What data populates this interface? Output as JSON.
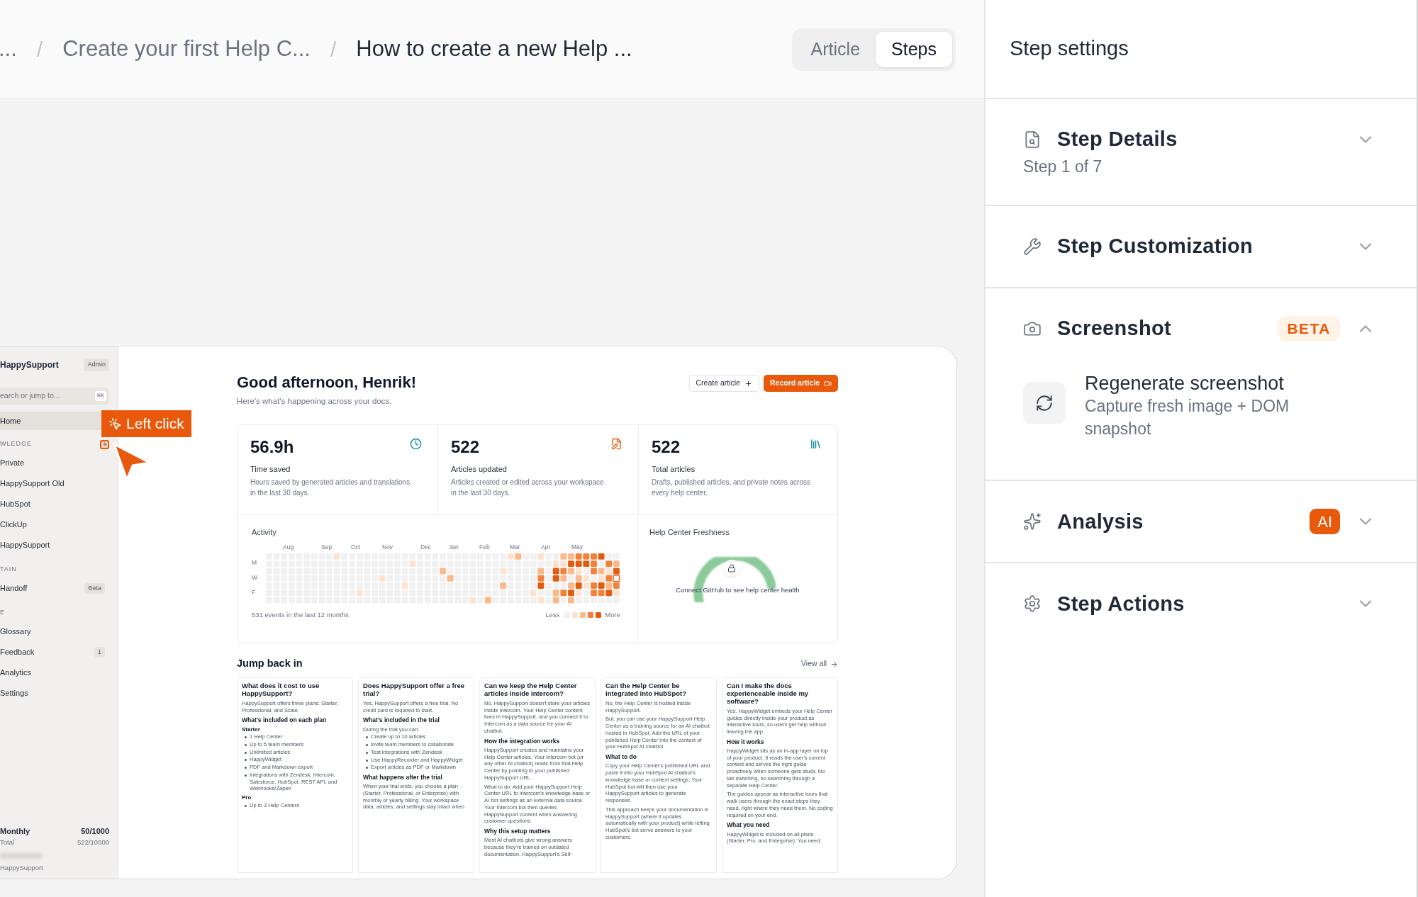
{
  "breadcrumb": [
    {
      "kind": "crumb",
      "label": "...",
      "current": false
    },
    {
      "kind": "separator",
      "label": "/"
    },
    {
      "kind": "crumb",
      "label": "Create your first Help C...",
      "current": false
    },
    {
      "kind": "separator",
      "label": "/"
    },
    {
      "kind": "crumb",
      "label": "How to create a new Help ...",
      "current": true
    }
  ],
  "view_tabs": [
    {
      "label": "Article",
      "selected": false
    },
    {
      "label": "Steps",
      "selected": true
    }
  ],
  "captured_screen": {
    "sidebar": {
      "brand": "HappySupport",
      "role_badge": "Admin",
      "search_placeholder": "earch or jump to...",
      "search_shortcut": "⌘K",
      "items": [
        {
          "kind": "item",
          "label": "Home",
          "selected": true
        },
        {
          "kind": "section",
          "label": "WLEDGE",
          "has_add": true
        },
        {
          "kind": "item",
          "label": "Private",
          "selected": false
        },
        {
          "kind": "item",
          "label": "HappySupport Old",
          "selected": false
        },
        {
          "kind": "item",
          "label": "HubSpot",
          "selected": false
        },
        {
          "kind": "item",
          "label": "ClickUp",
          "selected": false
        },
        {
          "kind": "item",
          "label": "HappySupport",
          "selected": false
        },
        {
          "kind": "section",
          "label": "TAIN",
          "has_add": false
        },
        {
          "kind": "item",
          "label": "Handoff",
          "selected": false,
          "badge": "Beta"
        },
        {
          "kind": "section",
          "label": "E",
          "has_add": false
        },
        {
          "kind": "item",
          "label": "Glossary",
          "selected": false
        },
        {
          "kind": "item",
          "label": "Feedback",
          "selected": false,
          "badge": "1"
        },
        {
          "kind": "item",
          "label": "Analytics",
          "selected": false
        },
        {
          "kind": "item",
          "label": "Settings",
          "selected": false
        }
      ],
      "usage": [
        {
          "label": "Monthly",
          "value": "50/1000"
        },
        {
          "label": "Total",
          "value": "522/10000"
        }
      ],
      "workspace": "HappySupport"
    },
    "greeting": "Good afternoon, Henrik!",
    "greeting_subtitle": "Here's what's happening across your docs.",
    "buttons": [
      {
        "label": "Create article",
        "kind": "secondary"
      },
      {
        "label": "Record article",
        "kind": "primary"
      }
    ],
    "stats": [
      {
        "value": "56.9h",
        "label": "Time saved",
        "description": "Hours saved by generated articles and translations in the last 30 days."
      },
      {
        "value": "522",
        "label": "Articles updated",
        "description": "Articles created or edited across your workspace in the last 30 days."
      },
      {
        "value": "522",
        "label": "Total articles",
        "description": "Drafts, published articles, and private notes across every help center."
      }
    ],
    "activity": {
      "title": "Activity",
      "months": [
        "Aug",
        "Sep",
        "Oct",
        "Nov",
        "Dec",
        "Jan",
        "Feb",
        "Mar",
        "Apr",
        "May"
      ],
      "days": [
        "M",
        "W",
        "F"
      ],
      "summary": "531 events in the last 12 months",
      "legend_less": "Less",
      "legend_more": "More"
    },
    "freshness": {
      "title": "Help Center Freshness",
      "message": "Connect GitHub to see help center health"
    },
    "jump_back": {
      "title": "Jump back in",
      "view_all": "View all",
      "cards": [
        {
          "blocks": [
            {
              "kind": "title",
              "text": "What does it cost to use HappySupport?"
            },
            {
              "kind": "text",
              "text": "HappySupport offers three plans: Starter, Professional, and Scale."
            },
            {
              "kind": "heading",
              "text": "What's included on each plan"
            },
            {
              "kind": "subheading",
              "text": "Starter"
            },
            {
              "kind": "bullet",
              "text": "1 Help Center"
            },
            {
              "kind": "bullet",
              "text": "Up to 5 team members"
            },
            {
              "kind": "bullet",
              "text": "Unlimited articles"
            },
            {
              "kind": "bullet",
              "text": "HappyWidget"
            },
            {
              "kind": "bullet",
              "text": "PDF and Markdown export"
            },
            {
              "kind": "bullet",
              "text": "Integrations with Zendesk, Intercom, Salesforce, HubSpot, REST API, and Webhooks/Zapier"
            },
            {
              "kind": "subheading",
              "text": "Pro"
            },
            {
              "kind": "bullet",
              "text": "Up to 3 Help Centers"
            }
          ]
        },
        {
          "blocks": [
            {
              "kind": "title",
              "text": "Does HappySupport offer a free trial?"
            },
            {
              "kind": "text",
              "text": "Yes, HappySupport offers a free trial. No credit card is required to start."
            },
            {
              "kind": "heading",
              "text": "What's included in the trial"
            },
            {
              "kind": "text",
              "text": "During the trial you can:"
            },
            {
              "kind": "bullet",
              "text": "Create up to 10 articles"
            },
            {
              "kind": "bullet",
              "text": "Invite team members to collaborate"
            },
            {
              "kind": "bullet",
              "text": "Test integrations with Zendesk"
            },
            {
              "kind": "bullet",
              "text": "Use HappyRecorder and HappyWidget"
            },
            {
              "kind": "bullet",
              "text": "Export articles as PDF or Markdown"
            },
            {
              "kind": "heading",
              "text": "What happens after the trial"
            },
            {
              "kind": "text",
              "text": "When your trial ends, you choose a plan (Starter, Professional, or Enterprise) with monthly or yearly billing. Your workspace data, articles, and settings stay intact when"
            }
          ]
        },
        {
          "blocks": [
            {
              "kind": "title",
              "text": "Can we keep the Help Center articles inside Intercom?"
            },
            {
              "kind": "text",
              "text": "No, HappySupport doesn't store your articles inside Intercom. Your Help Center content lives in HappySupport, and you connect it to Intercom as a data source for your AI chatbot."
            },
            {
              "kind": "heading",
              "text": "How the integration works"
            },
            {
              "kind": "text",
              "text": "HappySupport creates and maintains your Help Center articles. Your Intercom bot (or any other AI chatbot) reads from that Help Center by pointing to your published HappySupport URL."
            },
            {
              "kind": "text",
              "text": "What to do: Add your HappySupport Help Center URL to Intercom's knowledge base or AI bot settings as an external data source. Your Intercom bot then queries HappySupport content when answering customer questions."
            },
            {
              "kind": "heading",
              "text": "Why this setup matters"
            },
            {
              "kind": "text",
              "text": "Most AI chatbots give wrong answers because they're trained on outdated documentation. HappySupport's Self-"
            }
          ]
        },
        {
          "blocks": [
            {
              "kind": "title",
              "text": "Can the Help Center be integrated into HubSpot?"
            },
            {
              "kind": "text",
              "text": "No, the Help Center is hosted inside HappySupport."
            },
            {
              "kind": "text",
              "text": "But, you can use your HappySupport Help Center as a training source for an AI chatbot hosted in HubSpot. Add the URL of your published Help Center into the context of your HubSpot AI chatbot."
            },
            {
              "kind": "heading",
              "text": "What to do"
            },
            {
              "kind": "text",
              "text": "Copy your Help Center's published URL and paste it into your HubSpot AI chatbot's knowledge base or context settings. Your HubSpot bot will then use your HappySupport articles to generate responses."
            },
            {
              "kind": "text",
              "text": "This approach keeps your documentation in HappySupport (where it updates automatically with your product) while letting HubSpot's bot serve answers to your customers."
            }
          ]
        },
        {
          "blocks": [
            {
              "kind": "title",
              "text": "Can I make the docs experienceable inside my software?"
            },
            {
              "kind": "text",
              "text": "Yes. HappyWidget embeds your Help Center guides directly inside your product as interactive tours, so users get help without leaving the app."
            },
            {
              "kind": "heading",
              "text": "How it works"
            },
            {
              "kind": "text",
              "text": "HappyWidget sits as an in-app layer on top of your product. It reads the user's current context and serves the right guide proactively when someone gets stuck. No tab switching, no searching through a separate Help Center."
            },
            {
              "kind": "text",
              "text": "The guides appear as interactive tours that walk users through the exact steps they need, right where they need them. No coding required on your end."
            },
            {
              "kind": "heading",
              "text": "What you need"
            },
            {
              "kind": "text",
              "text": "HappyWidget is included on all plans (Starter, Pro, and Enterprise). You need:"
            }
          ]
        }
      ]
    }
  },
  "click_marker": {
    "label": "Left click"
  },
  "step_settings": {
    "title": "Step settings",
    "sections": [
      {
        "title": "Step Details",
        "subtitle": "Step 1 of 7",
        "expanded": false
      },
      {
        "title": "Step Customization",
        "expanded": false
      },
      {
        "title": "Screenshot",
        "expanded": true,
        "badge": {
          "label": "BETA",
          "kind": "soft"
        },
        "action": {
          "title": "Regenerate screenshot",
          "description": "Capture fresh image + DOM snapshot"
        }
      },
      {
        "title": "Analysis",
        "expanded": false,
        "badge": {
          "label": "AI",
          "kind": "solid"
        }
      },
      {
        "title": "Step Actions",
        "expanded": false
      }
    ]
  }
}
